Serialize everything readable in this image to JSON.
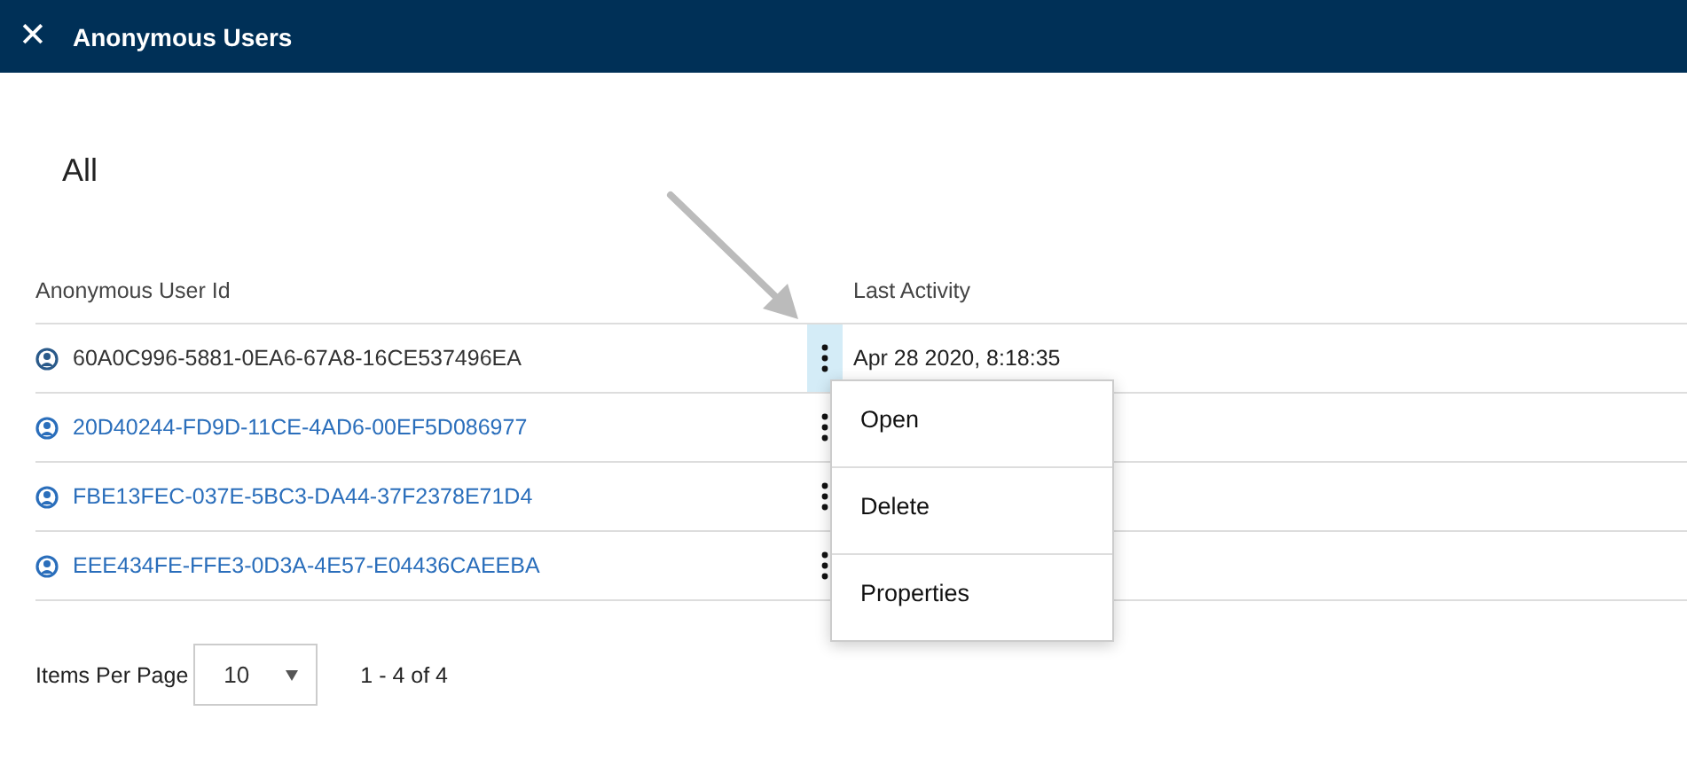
{
  "window": {
    "title": "Anonymous Users",
    "close_icon": "✕"
  },
  "view": {
    "title": "All"
  },
  "table": {
    "columns": [
      "Anonymous User Id",
      "Last Activity"
    ],
    "rows": [
      {
        "user_id": "60A0C996-5881-0EA6-67A8-16CE537496EA",
        "last_activity": "Apr 28 2020, 8:18:35",
        "selected": true
      },
      {
        "user_id": "20D40244-FD9D-11CE-4AD6-00EF5D086977",
        "selected": false
      },
      {
        "user_id": "FBE13FEC-037E-5BC3-DA44-37F2378E71D4",
        "selected": false
      },
      {
        "user_id": "EEE434FE-FFE3-0D3A-4E57-E04436CAEEBA",
        "selected": false
      }
    ]
  },
  "context_menu": {
    "items": [
      "Open",
      "Delete",
      "Properties"
    ]
  },
  "pagination": {
    "label": "Items Per Page",
    "page_size": "10",
    "range": "1 - 4 of 4"
  }
}
